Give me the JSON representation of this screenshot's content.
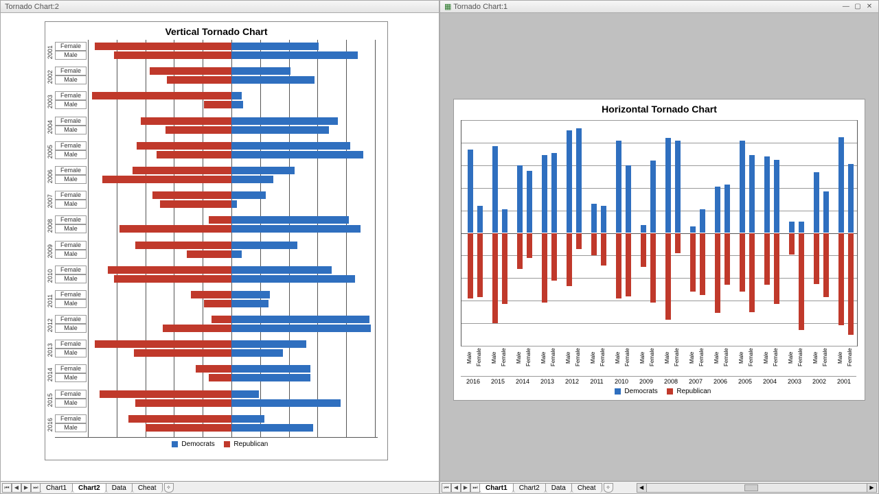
{
  "left": {
    "window_title": "Tornado Chart:2",
    "chart_title": "Vertical Tornado  Chart",
    "legend": {
      "blue": "Democrats",
      "red": "Republican"
    },
    "tabs": [
      "Chart1",
      "Chart2",
      "Data",
      "Cheat"
    ],
    "tab_active": "Chart2"
  },
  "right": {
    "window_title": "Tornado Chart:1",
    "chart_title": "Horizontal Tornado  Chart",
    "legend": {
      "blue": "Democrats",
      "red": "Republican"
    },
    "tabs": [
      "Chart1",
      "Chart2",
      "Data",
      "Cheat"
    ],
    "tab_active": "Chart1"
  },
  "chart_data": [
    {
      "id": "vertical_tornado",
      "type": "tornado-bar",
      "orientation": "horizontal-bars",
      "title": "Vertical Tornado Chart",
      "categories_outer": [
        "2001",
        "2002",
        "2003",
        "2004",
        "2005",
        "2006",
        "2007",
        "2008",
        "2009",
        "2010",
        "2011",
        "2012",
        "2013",
        "2014",
        "2015",
        "2016"
      ],
      "categories_inner": [
        "Female",
        "Male"
      ],
      "series": [
        {
          "name": "Democrats",
          "color": "#2f6fbf",
          "sign": "positive"
        },
        {
          "name": "Republican",
          "color": "#c0392b",
          "sign": "negative"
        }
      ],
      "xlim": [
        -10,
        10
      ],
      "data": {
        "2001": {
          "Female": {
            "Democrats": 6.1,
            "Republican": 9.5
          },
          "Male": {
            "Democrats": 8.8,
            "Republican": 8.2
          }
        },
        "2002": {
          "Female": {
            "Democrats": 4.1,
            "Republican": 5.7
          },
          "Male": {
            "Democrats": 5.8,
            "Republican": 4.5
          }
        },
        "2003": {
          "Female": {
            "Democrats": 0.7,
            "Republican": 9.7
          },
          "Male": {
            "Democrats": 0.8,
            "Republican": 1.9
          }
        },
        "2004": {
          "Female": {
            "Democrats": 7.4,
            "Republican": 6.3
          },
          "Male": {
            "Democrats": 6.8,
            "Republican": 4.6
          }
        },
        "2005": {
          "Female": {
            "Democrats": 8.3,
            "Republican": 6.6
          },
          "Male": {
            "Democrats": 9.2,
            "Republican": 5.2
          }
        },
        "2006": {
          "Female": {
            "Democrats": 4.4,
            "Republican": 6.9
          },
          "Male": {
            "Democrats": 2.9,
            "Republican": 9.0
          }
        },
        "2007": {
          "Female": {
            "Democrats": 2.4,
            "Republican": 5.5
          },
          "Male": {
            "Democrats": 0.4,
            "Republican": 5.0
          }
        },
        "2008": {
          "Female": {
            "Democrats": 8.2,
            "Republican": 1.6
          },
          "Male": {
            "Democrats": 9.0,
            "Republican": 7.8
          }
        },
        "2009": {
          "Female": {
            "Democrats": 4.6,
            "Republican": 6.7
          },
          "Male": {
            "Democrats": 0.7,
            "Republican": 3.1
          }
        },
        "2010": {
          "Female": {
            "Democrats": 7.0,
            "Republican": 8.6
          },
          "Male": {
            "Democrats": 8.6,
            "Republican": 8.2
          }
        },
        "2011": {
          "Female": {
            "Democrats": 2.7,
            "Republican": 2.8
          },
          "Male": {
            "Democrats": 2.6,
            "Republican": 1.9
          }
        },
        "2012": {
          "Female": {
            "Democrats": 9.6,
            "Republican": 1.4
          },
          "Male": {
            "Democrats": 9.7,
            "Republican": 4.8
          }
        },
        "2013": {
          "Female": {
            "Democrats": 5.2,
            "Republican": 9.5
          },
          "Male": {
            "Democrats": 3.6,
            "Republican": 6.8
          }
        },
        "2014": {
          "Female": {
            "Democrats": 5.5,
            "Republican": 2.5
          },
          "Male": {
            "Democrats": 5.5,
            "Republican": 1.6
          }
        },
        "2015": {
          "Female": {
            "Democrats": 1.9,
            "Republican": 9.2
          },
          "Male": {
            "Democrats": 7.6,
            "Republican": 6.7
          }
        },
        "2016": {
          "Female": {
            "Democrats": 2.3,
            "Republican": 7.2
          },
          "Male": {
            "Democrats": 5.7,
            "Republican": 6.0
          }
        }
      }
    },
    {
      "id": "horizontal_tornado",
      "type": "tornado-bar",
      "orientation": "vertical-bars",
      "title": "Horizontal Tornado Chart",
      "categories_outer": [
        "2016",
        "2015",
        "2014",
        "2013",
        "2012",
        "2011",
        "2010",
        "2009",
        "2008",
        "2007",
        "2006",
        "2005",
        "2004",
        "2003",
        "2002",
        "2001"
      ],
      "categories_inner": [
        "Male",
        "Female"
      ],
      "series": [
        {
          "name": "Democrats",
          "color": "#2f6fbf",
          "sign": "positive"
        },
        {
          "name": "Republican",
          "color": "#c0392b",
          "sign": "negative"
        }
      ],
      "ylim": [
        -10,
        10
      ],
      "data": {
        "2016": {
          "Male": {
            "Democrats": 7.4,
            "Republican": 5.8
          },
          "Female": {
            "Democrats": 2.4,
            "Republican": 5.7
          }
        },
        "2015": {
          "Male": {
            "Democrats": 7.7,
            "Republican": 8.0
          },
          "Female": {
            "Democrats": 2.1,
            "Republican": 6.3
          }
        },
        "2014": {
          "Male": {
            "Democrats": 6.0,
            "Republican": 3.2
          },
          "Female": {
            "Democrats": 5.5,
            "Republican": 2.2
          }
        },
        "2013": {
          "Male": {
            "Democrats": 6.9,
            "Republican": 6.2
          },
          "Female": {
            "Democrats": 7.1,
            "Republican": 4.2
          }
        },
        "2012": {
          "Male": {
            "Democrats": 9.1,
            "Republican": 4.7
          },
          "Female": {
            "Democrats": 9.3,
            "Republican": 1.4
          }
        },
        "2011": {
          "Male": {
            "Democrats": 2.6,
            "Republican": 2.0
          },
          "Female": {
            "Democrats": 2.4,
            "Republican": 2.9
          }
        },
        "2010": {
          "Male": {
            "Democrats": 8.2,
            "Republican": 5.8
          },
          "Female": {
            "Democrats": 6.0,
            "Republican": 5.6
          }
        },
        "2009": {
          "Male": {
            "Democrats": 0.7,
            "Republican": 3.0
          },
          "Female": {
            "Democrats": 6.4,
            "Republican": 6.2
          }
        },
        "2008": {
          "Male": {
            "Democrats": 8.4,
            "Republican": 7.7
          },
          "Female": {
            "Democrats": 8.2,
            "Republican": 1.8
          }
        },
        "2007": {
          "Male": {
            "Democrats": 0.6,
            "Republican": 5.2
          },
          "Female": {
            "Democrats": 2.1,
            "Republican": 5.5
          }
        },
        "2006": {
          "Male": {
            "Democrats": 4.1,
            "Republican": 7.1
          },
          "Female": {
            "Democrats": 4.3,
            "Republican": 4.6
          }
        },
        "2005": {
          "Male": {
            "Democrats": 8.2,
            "Republican": 5.2
          },
          "Female": {
            "Democrats": 6.9,
            "Republican": 7.0
          }
        },
        "2004": {
          "Male": {
            "Democrats": 6.8,
            "Republican": 4.6
          },
          "Female": {
            "Democrats": 6.5,
            "Republican": 6.3
          }
        },
        "2003": {
          "Male": {
            "Democrats": 1.0,
            "Republican": 1.9
          },
          "Female": {
            "Democrats": 1.0,
            "Republican": 8.6
          }
        },
        "2002": {
          "Male": {
            "Democrats": 5.4,
            "Republican": 4.5
          },
          "Female": {
            "Democrats": 3.7,
            "Republican": 5.7
          }
        },
        "2001": {
          "Male": {
            "Democrats": 8.5,
            "Republican": 8.2
          },
          "Female": {
            "Democrats": 6.1,
            "Republican": 9.0
          }
        }
      }
    }
  ]
}
